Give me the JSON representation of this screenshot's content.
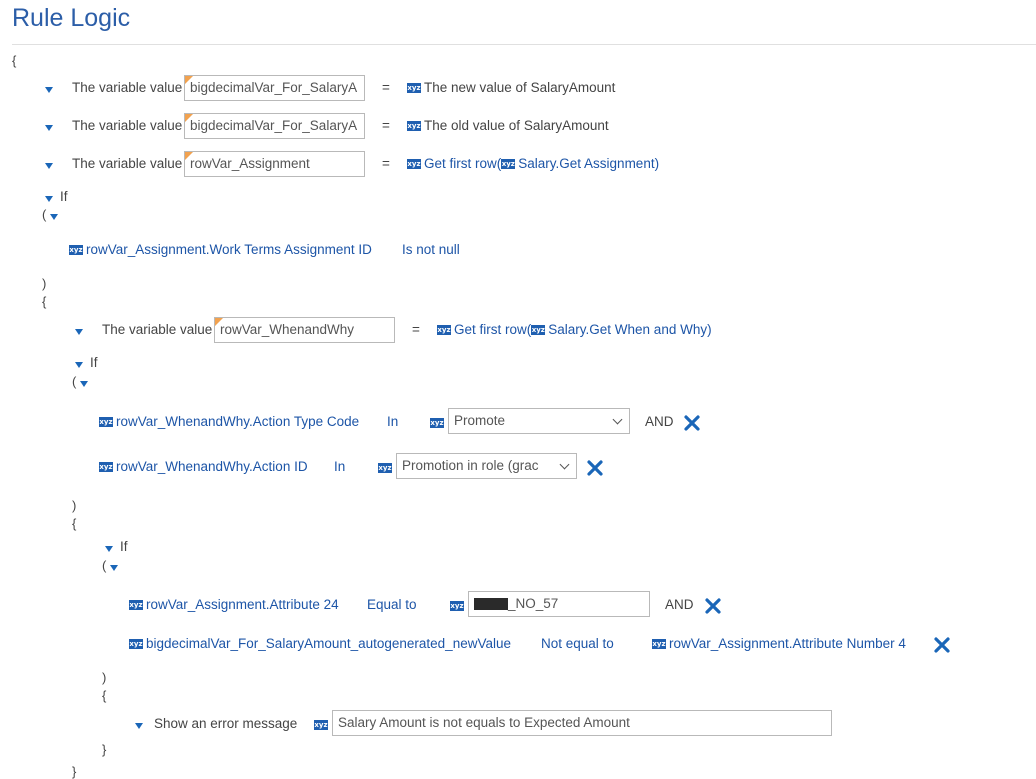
{
  "page": {
    "title": "Rule Logic"
  },
  "braces": {
    "open": "{",
    "close": "}",
    "paren_open": "(",
    "paren_close": ")"
  },
  "icon_label": "xyz",
  "assignments": [
    {
      "label": "The variable value",
      "var": "bigdecimalVar_For_SalaryA",
      "op": "=",
      "value": "The new value of SalaryAmount"
    },
    {
      "label": "The variable value",
      "var": "bigdecimalVar_For_SalaryA",
      "op": "=",
      "value": "The old value of SalaryAmount"
    },
    {
      "label": "The variable value",
      "var": "rowVar_Assignment",
      "op": "=",
      "value_pre": "Get first row(",
      "value_inner": "Salary.Get Assignment",
      "value_post": ")"
    }
  ],
  "if1": {
    "keyword": "If",
    "condition": {
      "field": "rowVar_Assignment.Work Terms Assignment ID",
      "op": "Is not null"
    },
    "assignment": {
      "label": "The variable value",
      "var": "rowVar_WhenandWhy",
      "op": "=",
      "value_pre": "Get first row(",
      "value_inner": "Salary.Get When and Why",
      "value_post": ")"
    }
  },
  "if2": {
    "keyword": "If",
    "conditions": [
      {
        "field": "rowVar_WhenandWhy.Action Type Code",
        "op": "In",
        "selected": "Promote",
        "join": "AND"
      },
      {
        "field": "rowVar_WhenandWhy.Action ID",
        "op": "In",
        "selected": "Promotion in role (grac"
      }
    ]
  },
  "if3": {
    "keyword": "If",
    "conditions": [
      {
        "field": "rowVar_Assignment.Attribute 24",
        "op": "Equal to",
        "value": "_NO_57",
        "join": "AND"
      },
      {
        "field": "bigdecimalVar_For_SalaryAmount_autogenerated_newValue",
        "op": "Not equal to",
        "value": "rowVar_Assignment.Attribute Number 4"
      }
    ],
    "action": {
      "label": "Show an error message",
      "message": "Salary Amount is not equals to Expected Amount"
    }
  },
  "colors": {
    "title": "#2c5ea8",
    "link": "#1d55a7",
    "icon": "#1f5fb0",
    "delete": "#1a66b8",
    "field_marker": "#f2a24f"
  }
}
